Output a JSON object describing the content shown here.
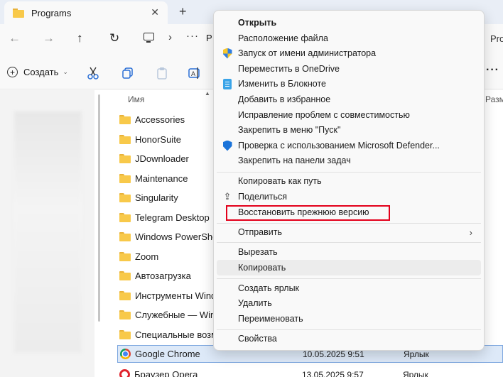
{
  "tab": {
    "title": "Programs",
    "close": "✕",
    "add": "+"
  },
  "nav": {
    "back": "←",
    "forward": "→",
    "up": "↑",
    "refresh": "↻",
    "chevron": "›",
    "ellipsis": "···",
    "addr_partial": "P",
    "search_partial": "Pro"
  },
  "toolbar": {
    "create_label": "Создать",
    "create_chevron": "⌄",
    "more": "···"
  },
  "columns": {
    "name": "Имя",
    "size": "Разм"
  },
  "files": [
    {
      "name": "Accessories",
      "type": "folder"
    },
    {
      "name": "HonorSuite",
      "type": "folder"
    },
    {
      "name": "JDownloader",
      "type": "folder"
    },
    {
      "name": "Maintenance",
      "type": "folder"
    },
    {
      "name": "Singularity",
      "type": "folder"
    },
    {
      "name": "Telegram Desktop",
      "type": "folder"
    },
    {
      "name": "Windows PowerShell",
      "type": "folder"
    },
    {
      "name": "Zoom",
      "type": "folder"
    },
    {
      "name": "Автозагрузка",
      "type": "folder"
    },
    {
      "name": "Инструменты Windo",
      "type": "folder"
    },
    {
      "name": "Служебные — Wind",
      "type": "folder"
    },
    {
      "name": "Специальные возмо",
      "type": "folder"
    },
    {
      "name": "Google Chrome",
      "date": "10.05.2025 9:51",
      "kind": "Ярлык",
      "type": "chrome",
      "selected": true
    },
    {
      "name": "Браузер Opera",
      "date": "13.05.2025 9:57",
      "kind": "Ярлык",
      "type": "opera"
    }
  ],
  "context_menu": {
    "items": [
      {
        "label": "Открыть",
        "icon": "",
        "bold": true
      },
      {
        "label": "Расположение файла",
        "icon": ""
      },
      {
        "label": "Запуск от имени администратора",
        "icon": "uac-shield-icon"
      },
      {
        "label": "Переместить в OneDrive",
        "icon": ""
      },
      {
        "label": "Изменить в Блокноте",
        "icon": "notepad-icon"
      },
      {
        "label": "Добавить в избранное",
        "icon": ""
      },
      {
        "label": "Исправление проблем с совместимостью",
        "icon": ""
      },
      {
        "label": "Закрепить в меню \"Пуск\"",
        "icon": ""
      },
      {
        "label": "Проверка с использованием Microsoft Defender...",
        "icon": "defender-shield-icon"
      },
      {
        "label": "Закрепить на панели задач",
        "icon": ""
      },
      {
        "label": "Копировать как путь",
        "icon": ""
      },
      {
        "label": "Поделиться",
        "icon": "share-icon"
      },
      {
        "label": "Восстановить прежнюю версию",
        "icon": "",
        "highlighted": true
      },
      {
        "label": "Отправить",
        "icon": "",
        "submenu": true,
        "arrow": "›"
      },
      {
        "label": "Вырезать",
        "icon": ""
      },
      {
        "label": "Копировать",
        "icon": "",
        "hover": true
      },
      {
        "label": "Создать ярлык",
        "icon": ""
      },
      {
        "label": "Удалить",
        "icon": ""
      },
      {
        "label": "Переименовать",
        "icon": ""
      },
      {
        "label": "Свойства",
        "icon": ""
      }
    ],
    "highlight_color": "#e3001b"
  }
}
